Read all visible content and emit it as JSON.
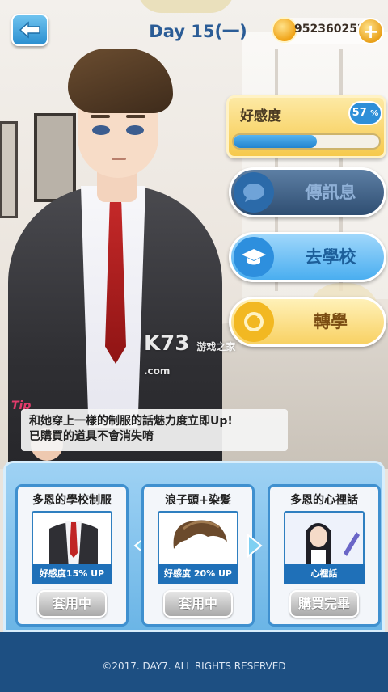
{
  "header": {
    "day_title": "Day 15(一)",
    "coins": "952360252",
    "back_icon": "arrow-left-icon",
    "coin_icon": "coin-icon",
    "plus_icon": "plus-icon"
  },
  "affection": {
    "label": "好感度",
    "percent_text": "57",
    "percent_sign": "%",
    "level": 0.57
  },
  "menu": [
    {
      "label": "傳訊息",
      "icon": "chat-bubble-icon"
    },
    {
      "label": "去學校",
      "icon": "graduation-cap-icon"
    },
    {
      "label": "轉學",
      "icon": "transfer-cycle-icon"
    }
  ],
  "tip": {
    "tag": "Tip",
    "line1": "和她穿上一樣的制服的話魅力度立即Up!",
    "line2": "已購買的道具不會消失唷"
  },
  "watermark": {
    "main": "K73",
    "sub": "游戏之家",
    "domain": ".com"
  },
  "shop": {
    "items": [
      {
        "title": "多恩的學校制服",
        "sub": "好感度15% UP",
        "button": "套用中"
      },
      {
        "title": "浪子頭+染髮",
        "sub": "好感度 20% UP",
        "button": "套用中"
      },
      {
        "title": "多恩的心裡話",
        "sub": "心裡話",
        "button": "購買完畢"
      }
    ]
  },
  "footer": {
    "copyright": "©2017. DAY7. ALL RIGHTS RESERVED"
  },
  "colors": {
    "accent_blue": "#2e8fd8",
    "gold": "#f6c94c",
    "footer_bg": "#1d4f82",
    "title_blue": "#2b5c96"
  }
}
